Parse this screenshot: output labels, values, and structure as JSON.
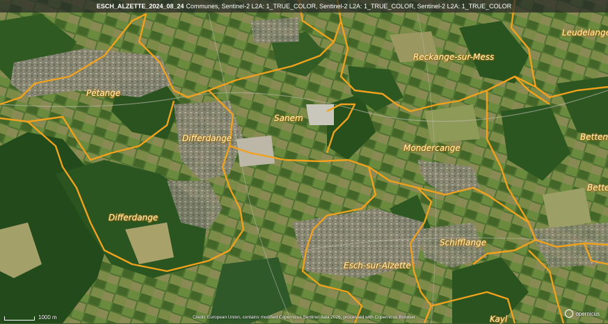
{
  "header": {
    "title": "ESCH_ALZETTE_2024_08_24",
    "layers": "Communes, Sentinel-2 L2A: 1_TRUE_COLOR, Sentinel-2 L2A: 1_TRUE_COLOR, Sentinel-2 L2A: 1_TRUE_COLOR"
  },
  "communes": [
    {
      "name": "Pétange"
    },
    {
      "name": "Sanem"
    },
    {
      "name": "Reckange-sur-Mess"
    },
    {
      "name": "Leudelange"
    },
    {
      "name": "Differdange"
    },
    {
      "name": "Differdange"
    },
    {
      "name": "Mondercange"
    },
    {
      "name": "Bettem"
    },
    {
      "name": "Bette"
    },
    {
      "name": "Schifflange"
    },
    {
      "name": "Esch-sur-Alzette"
    },
    {
      "name": "Kayl"
    }
  ],
  "scale": {
    "label": "1000 m"
  },
  "credit": "Credit: European Union, contains modified Copernicus Sentinel data 2026, processed with Copernicus Browser",
  "logo": {
    "text": "opernicus"
  },
  "colors": {
    "boundary": "#f0a21e",
    "label_fill": "#fff4c8",
    "label_halo": "#b77a10"
  }
}
